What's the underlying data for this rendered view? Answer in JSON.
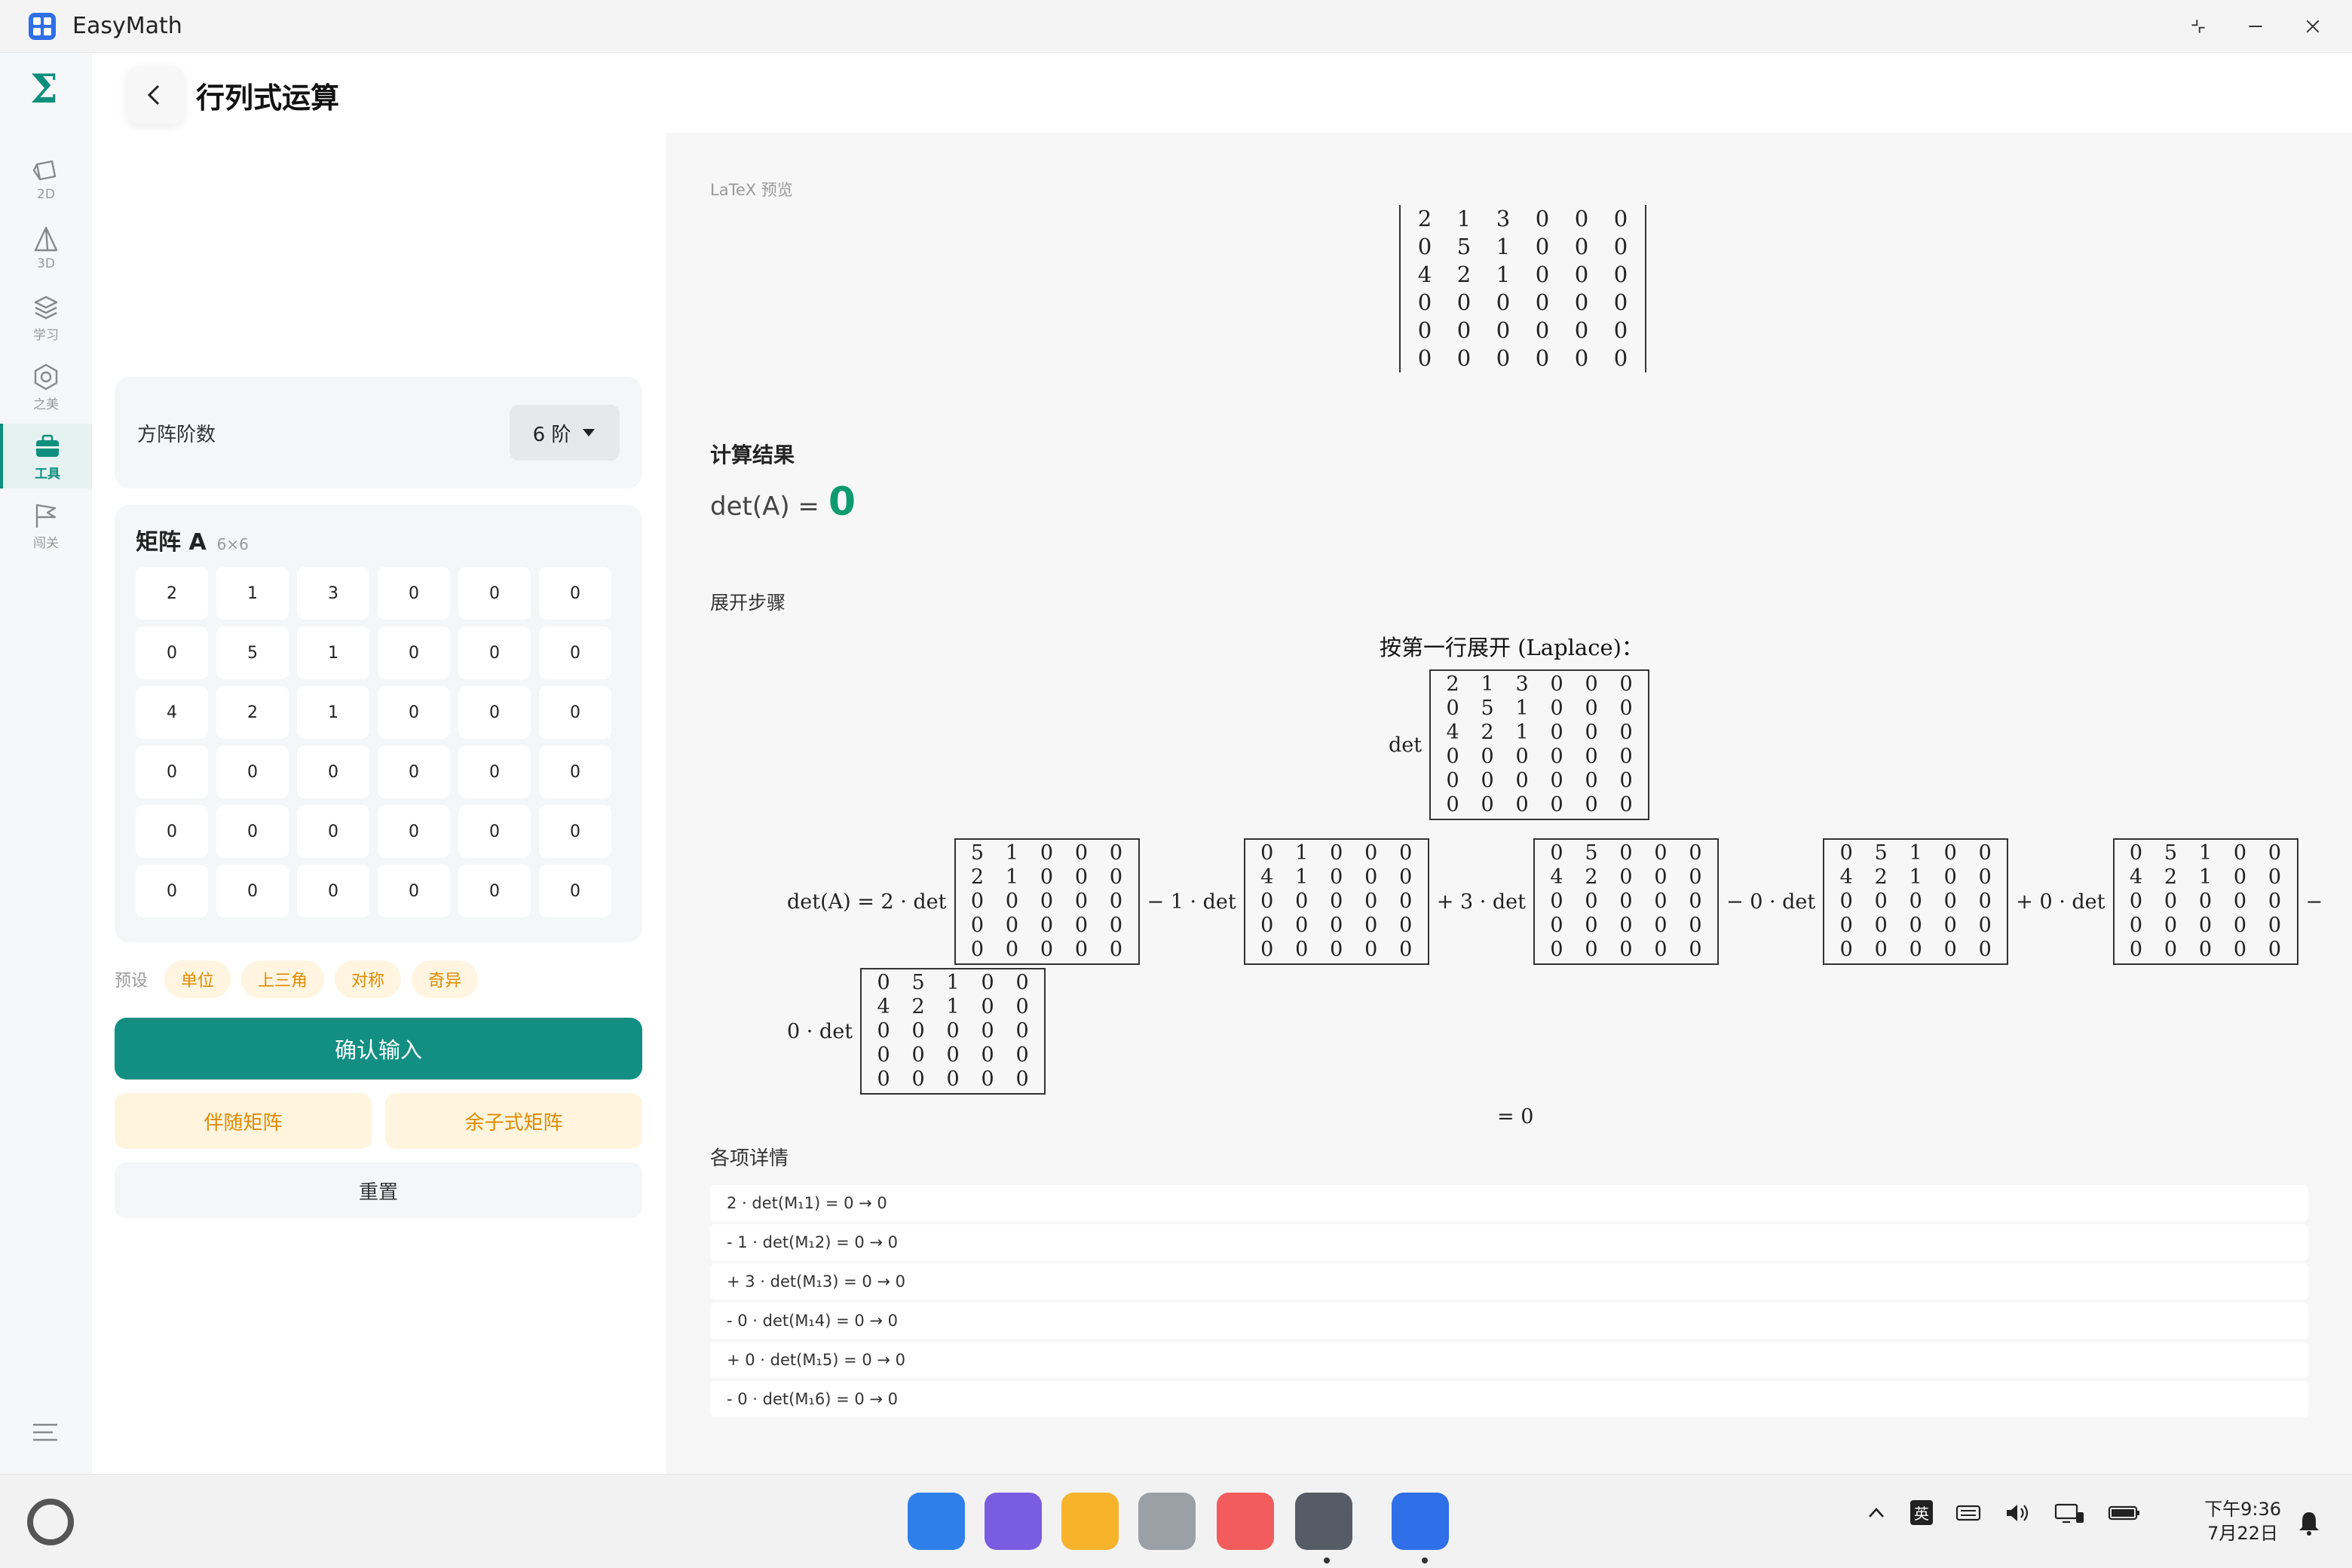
{
  "app": {
    "title": "EasyMath"
  },
  "window_controls": {
    "restore": "⌐",
    "minimize": "—",
    "close": "✕"
  },
  "sidebar": {
    "logo": "Σ",
    "items": [
      {
        "label": "2D",
        "icon": "shape-2d-icon"
      },
      {
        "label": "3D",
        "icon": "pyramid-3d-icon"
      },
      {
        "label": "学习",
        "icon": "layers-icon"
      },
      {
        "label": "之美",
        "icon": "hexagon-icon"
      },
      {
        "label": "工具",
        "icon": "toolbox-icon",
        "active": true
      },
      {
        "label": "闯关",
        "icon": "flag-icon"
      }
    ]
  },
  "page": {
    "title": "行列式运算"
  },
  "order": {
    "label": "方阵阶数",
    "value": "6 阶"
  },
  "matrix": {
    "title": "矩阵 A",
    "size": "6×6",
    "rows": [
      [
        "2",
        "1",
        "3",
        "0",
        "0",
        "0"
      ],
      [
        "0",
        "5",
        "1",
        "0",
        "0",
        "0"
      ],
      [
        "4",
        "2",
        "1",
        "0",
        "0",
        "0"
      ],
      [
        "0",
        "0",
        "0",
        "0",
        "0",
        "0"
      ],
      [
        "0",
        "0",
        "0",
        "0",
        "0",
        "0"
      ],
      [
        "0",
        "0",
        "0",
        "0",
        "0",
        "0"
      ]
    ]
  },
  "presets": {
    "label": "预设",
    "items": [
      "单位",
      "上三角",
      "对称",
      "奇异"
    ]
  },
  "buttons": {
    "confirm": "确认输入",
    "adjugate": "伴随矩阵",
    "cofactor": "余子式矩阵",
    "reset": "重置"
  },
  "preview": {
    "label": "LaTeX 预览"
  },
  "result": {
    "title": "计算结果",
    "prefix": "det(A) =",
    "value": "0"
  },
  "steps": {
    "label": "展开步骤",
    "laplace_title": "按第一行展开 (Laplace)：",
    "det_word": "det",
    "lhs": "det(A) = 2 · det",
    "terms": [
      {
        "sign": "− 1 · det",
        "minor": [
          [
            "0",
            "1",
            "0",
            "0",
            "0"
          ],
          [
            "4",
            "1",
            "0",
            "0",
            "0"
          ],
          [
            "0",
            "0",
            "0",
            "0",
            "0"
          ],
          [
            "0",
            "0",
            "0",
            "0",
            "0"
          ],
          [
            "0",
            "0",
            "0",
            "0",
            "0"
          ]
        ]
      },
      {
        "sign": "+ 3 · det",
        "minor": [
          [
            "0",
            "5",
            "0",
            "0",
            "0"
          ],
          [
            "4",
            "2",
            "0",
            "0",
            "0"
          ],
          [
            "0",
            "0",
            "0",
            "0",
            "0"
          ],
          [
            "0",
            "0",
            "0",
            "0",
            "0"
          ],
          [
            "0",
            "0",
            "0",
            "0",
            "0"
          ]
        ]
      },
      {
        "sign": "− 0 · det",
        "minor": [
          [
            "0",
            "5",
            "1",
            "0",
            "0"
          ],
          [
            "4",
            "2",
            "1",
            "0",
            "0"
          ],
          [
            "0",
            "0",
            "0",
            "0",
            "0"
          ],
          [
            "0",
            "0",
            "0",
            "0",
            "0"
          ],
          [
            "0",
            "0",
            "0",
            "0",
            "0"
          ]
        ]
      },
      {
        "sign": "+ 0 · det",
        "minor": [
          [
            "0",
            "5",
            "1",
            "0",
            "0"
          ],
          [
            "4",
            "2",
            "1",
            "0",
            "0"
          ],
          [
            "0",
            "0",
            "0",
            "0",
            "0"
          ],
          [
            "0",
            "0",
            "0",
            "0",
            "0"
          ],
          [
            "0",
            "0",
            "0",
            "0",
            "0"
          ]
        ]
      }
    ],
    "first_minor": [
      [
        "5",
        "1",
        "0",
        "0",
        "0"
      ],
      [
        "2",
        "1",
        "0",
        "0",
        "0"
      ],
      [
        "0",
        "0",
        "0",
        "0",
        "0"
      ],
      [
        "0",
        "0",
        "0",
        "0",
        "0"
      ],
      [
        "0",
        "0",
        "0",
        "0",
        "0"
      ]
    ],
    "trailing_sign": "−",
    "last_term": {
      "sign": "0 · det",
      "minor": [
        [
          "0",
          "5",
          "1",
          "0",
          "0"
        ],
        [
          "4",
          "2",
          "1",
          "0",
          "0"
        ],
        [
          "0",
          "0",
          "0",
          "0",
          "0"
        ],
        [
          "0",
          "0",
          "0",
          "0",
          "0"
        ],
        [
          "0",
          "0",
          "0",
          "0",
          "0"
        ]
      ]
    },
    "equals": "= 0"
  },
  "details": {
    "title": "各项详情",
    "rows": [
      "2 · det(M₁1) = 0 → 0",
      "- 1 · det(M₁2) = 0 → 0",
      "+ 3 · det(M₁3) = 0 → 0",
      "- 0 · det(M₁4) = 0 → 0",
      "+ 0 · det(M₁5) = 0 → 0",
      "- 0 · det(M₁6) = 0 → 0"
    ]
  },
  "taskbar": {
    "apps": [
      {
        "name": "app-grid-blue",
        "color": "#2f7fea"
      },
      {
        "name": "app-purple",
        "color": "#7a5ce0"
      },
      {
        "name": "files-app",
        "color": "#f7b32b"
      },
      {
        "name": "trash-app",
        "color": "#9aa0a6"
      },
      {
        "name": "photos-app",
        "color": "#f25c5c"
      },
      {
        "name": "settings-app",
        "color": "#555c66"
      },
      {
        "name": "easymath-app",
        "color": "#2f6fe8"
      }
    ],
    "ime": "英",
    "time": "下午9:36",
    "date": "7月22日"
  },
  "colors": {
    "accent": "#128f82",
    "warn": "#e08a00",
    "result": "#0e9b6e"
  }
}
